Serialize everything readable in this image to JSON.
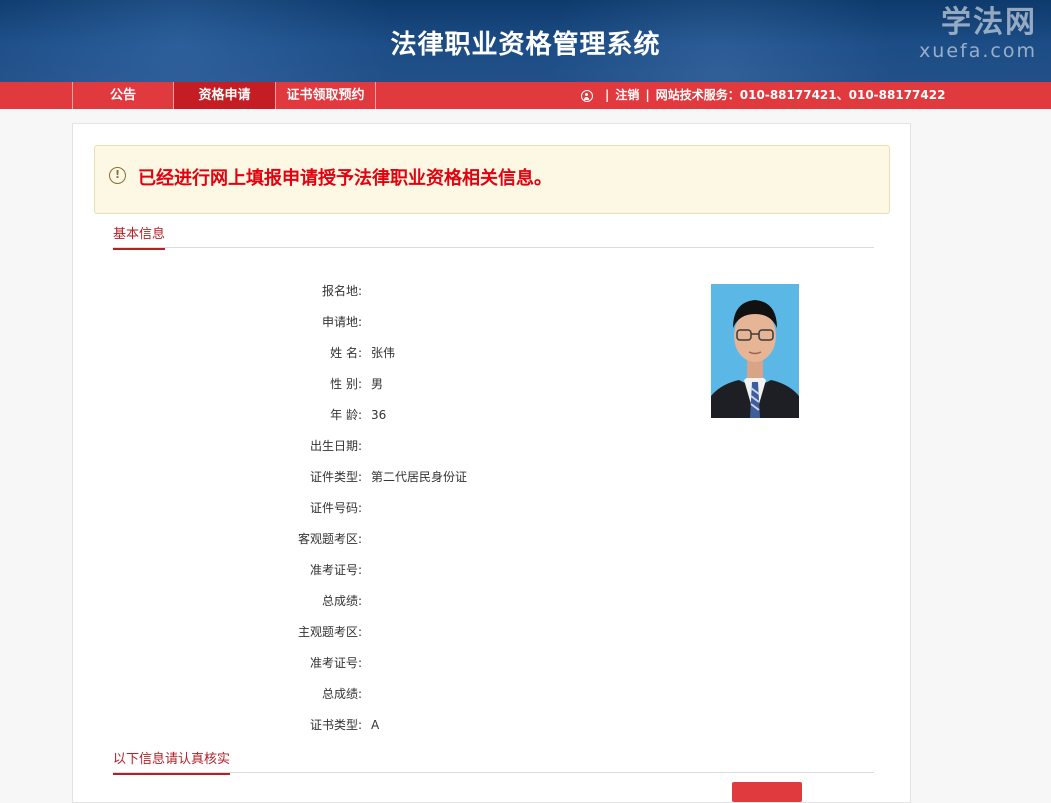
{
  "header": {
    "title": "法律职业资格管理系统",
    "brand_cn": "学法网",
    "brand_en": "xuefa.com"
  },
  "nav": {
    "tabs": [
      {
        "label": "公告"
      },
      {
        "label": "资格申请"
      },
      {
        "label": "证书领取预约"
      }
    ],
    "logout": "注销",
    "tech_service": "网站技术服务：010-88177421、010-88177422"
  },
  "alert": {
    "text": "已经进行网上填报申请授予法律职业资格相关信息。"
  },
  "basic_info": {
    "section_title": "基本信息",
    "fields": [
      {
        "label": "报名地:",
        "value": ""
      },
      {
        "label": "申请地:",
        "value": ""
      },
      {
        "label": "姓 名:",
        "value": "张伟"
      },
      {
        "label": "性 别:",
        "value": "男"
      },
      {
        "label": "年 龄:",
        "value": "36"
      },
      {
        "label": "出生日期:",
        "value": ""
      },
      {
        "label": "证件类型:",
        "value": "第二代居民身份证"
      },
      {
        "label": "证件号码:",
        "value": ""
      },
      {
        "label": "客观题考区:",
        "value": ""
      },
      {
        "label": "准考证号:",
        "value": ""
      },
      {
        "label": "总成绩:",
        "value": ""
      },
      {
        "label": "主观题考区:",
        "value": ""
      },
      {
        "label": "准考证号:",
        "value": ""
      },
      {
        "label": "总成绩:",
        "value": ""
      },
      {
        "label": "证书类型:",
        "value": "A"
      }
    ]
  },
  "verify_section": {
    "title": "以下信息请认真核实"
  },
  "colors": {
    "header_blue": "#1c4d86",
    "nav_red": "#e0393e",
    "nav_active": "#c41d24",
    "alert_text": "#e3000f",
    "section_accent": "#b51f25"
  }
}
